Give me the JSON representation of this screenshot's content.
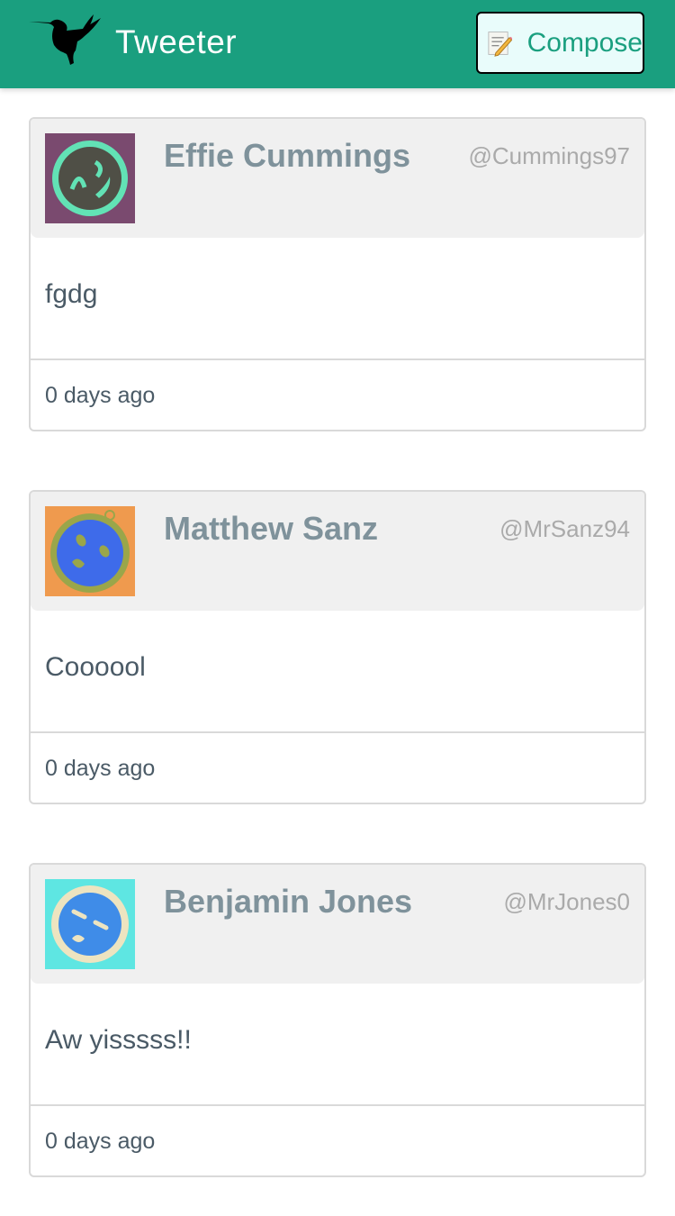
{
  "header": {
    "brand": "Tweeter",
    "compose_label": "Compose",
    "color": "#1a9f7f"
  },
  "tweets": [
    {
      "name": "Effie Cummings",
      "handle": "@Cummings97",
      "text": "fgdg",
      "time": "0 days ago",
      "avatar_bg": "#7a4a6f",
      "avatar_ring": "#62e2b5",
      "avatar_face": "#4f4f46"
    },
    {
      "name": "Matthew Sanz",
      "handle": "@MrSanz94",
      "text": "Coooool",
      "time": "0 days ago",
      "avatar_bg": "#ef9a4e",
      "avatar_ring": "#9aa64a",
      "avatar_face": "#3e6bea"
    },
    {
      "name": "Benjamin Jones",
      "handle": "@MrJones0",
      "text": "Aw yisssss!!",
      "time": "0 days ago",
      "avatar_bg": "#5ee6e2",
      "avatar_ring": "#ede4c0",
      "avatar_face": "#3f8ce8"
    }
  ]
}
